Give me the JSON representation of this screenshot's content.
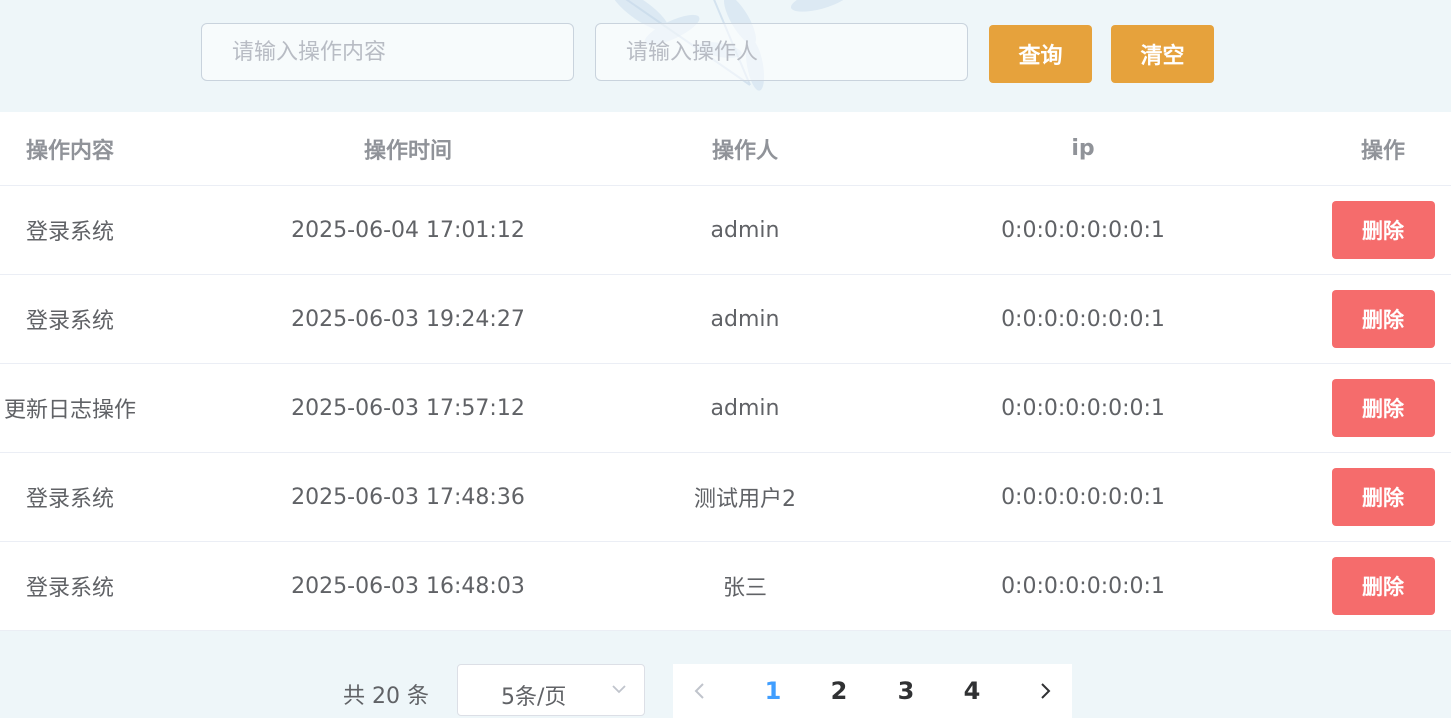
{
  "search": {
    "content_placeholder": "请输入操作内容",
    "operator_placeholder": "请输入操作人",
    "query_label": "查询",
    "clear_label": "清空"
  },
  "table": {
    "columns": [
      "操作内容",
      "操作时间",
      "操作人",
      "ip",
      "操作"
    ],
    "rows": [
      {
        "content": "登录系统",
        "time": "2025-06-04 17:01:12",
        "operator": "admin",
        "ip": "0:0:0:0:0:0:0:1",
        "action": "删除"
      },
      {
        "content": "登录系统",
        "time": "2025-06-03 19:24:27",
        "operator": "admin",
        "ip": "0:0:0:0:0:0:0:1",
        "action": "删除"
      },
      {
        "content": "更新日志操作",
        "time": "2025-06-03 17:57:12",
        "operator": "admin",
        "ip": "0:0:0:0:0:0:0:1",
        "action": "删除"
      },
      {
        "content": "登录系统",
        "time": "2025-06-03 17:48:36",
        "operator": "测试用户2",
        "ip": "0:0:0:0:0:0:0:1",
        "action": "删除"
      },
      {
        "content": "登录系统",
        "time": "2025-06-03 16:48:03",
        "operator": "张三",
        "ip": "0:0:0:0:0:0:0:1",
        "action": "删除"
      }
    ]
  },
  "pagination": {
    "total_text": "共 20 条",
    "page_size": "5条/页",
    "pages": [
      "1",
      "2",
      "3",
      "4"
    ],
    "current_page": "1"
  },
  "colors": {
    "warning": "#e6a23c",
    "danger": "#f56c6c",
    "primary": "#409eff",
    "background": "#eef6f9"
  },
  "icons": {
    "page_size_dropdown": "chevron-down-icon",
    "prev": "chevron-left-icon",
    "next": "chevron-right-icon"
  }
}
